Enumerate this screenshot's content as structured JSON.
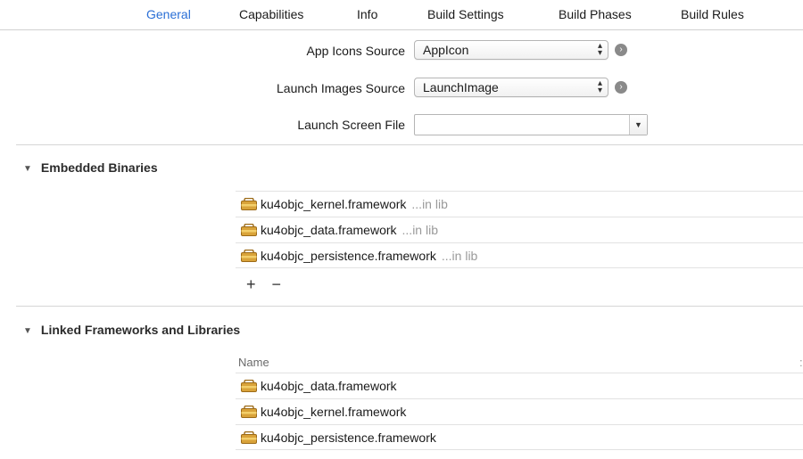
{
  "tabs": [
    {
      "label": "General",
      "active": true
    },
    {
      "label": "Capabilities",
      "active": false
    },
    {
      "label": "Info",
      "active": false
    },
    {
      "label": "Build Settings",
      "active": false
    },
    {
      "label": "Build Phases",
      "active": false
    },
    {
      "label": "Build Rules",
      "active": false
    }
  ],
  "app_icons": {
    "label": "App Icons Source",
    "value": "AppIcon"
  },
  "launch_images": {
    "label": "Launch Images Source",
    "value": "LaunchImage"
  },
  "launch_screen": {
    "label": "Launch Screen File",
    "value": ""
  },
  "embedded": {
    "title": "Embedded Binaries",
    "items": [
      {
        "name": "ku4objc_kernel.framework",
        "location": "...in lib"
      },
      {
        "name": "ku4objc_data.framework",
        "location": "...in lib"
      },
      {
        "name": "ku4objc_persistence.framework",
        "location": "...in lib"
      }
    ],
    "add_label": "+",
    "remove_label": "−"
  },
  "linked": {
    "title": "Linked Frameworks and Libraries",
    "column_name": "Name",
    "items": [
      {
        "name": "ku4objc_data.framework"
      },
      {
        "name": "ku4objc_kernel.framework"
      },
      {
        "name": "ku4objc_persistence.framework"
      }
    ]
  },
  "colors": {
    "accent": "#2a6fd6",
    "icon_body": "#d9a33a",
    "icon_band": "#f3cf6b"
  },
  "icons": {
    "framework": "toolbox-icon",
    "go": "arrow-right-circle-icon"
  }
}
